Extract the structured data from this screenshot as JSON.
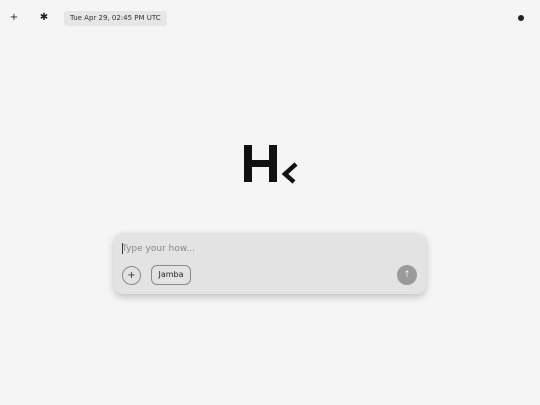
{
  "topbar": {
    "new_icon_glyph": "+",
    "settings_icon_glyph": "✱",
    "timestamp": "Tue Apr 29, 02:45 PM UTC",
    "status_icon": "dot-icon"
  },
  "logo": {
    "icon": "logo-mark"
  },
  "composer": {
    "placeholder": "Type your how...",
    "add_glyph": "+",
    "model_label": "Jamba",
    "send_glyph": "↑"
  },
  "colors": {
    "background": "#f5f5f5",
    "composer_bg": "#e3e3e3",
    "send_bg": "#9a9a9a",
    "timestamp_bg": "#e6e6e6"
  }
}
